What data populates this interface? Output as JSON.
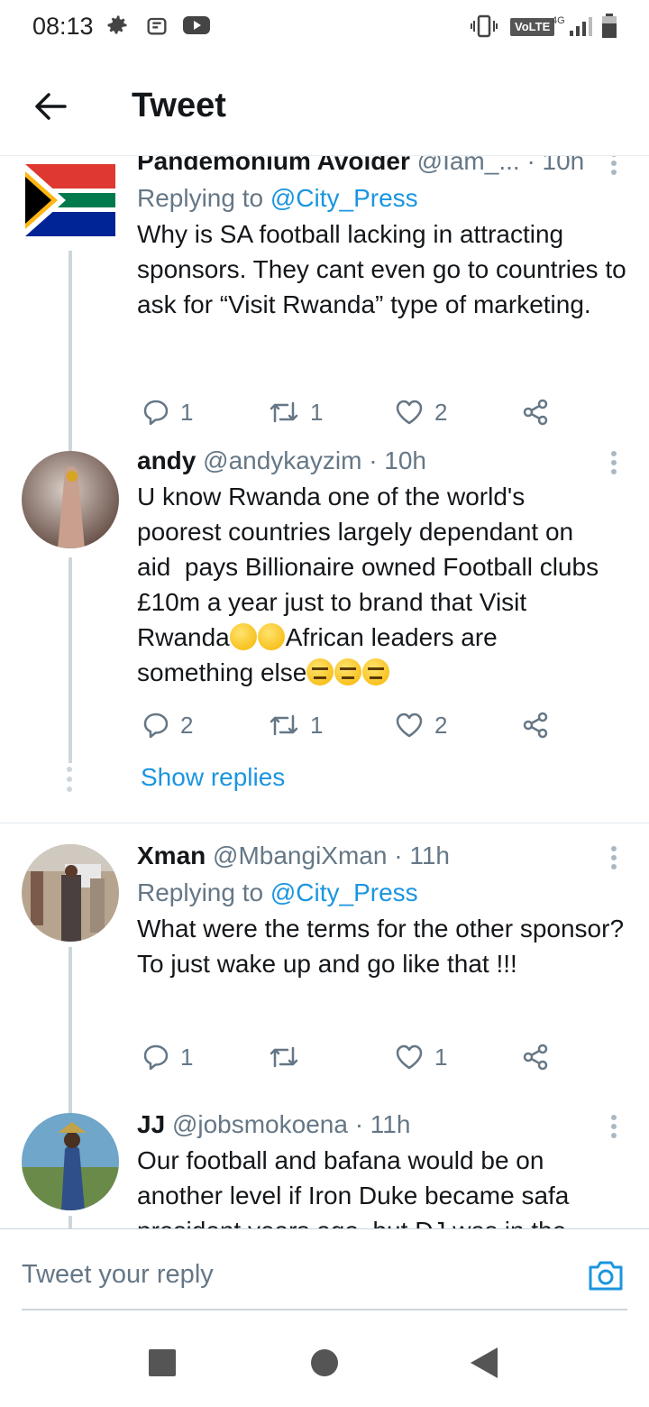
{
  "status_bar": {
    "time": "08:13",
    "icons": [
      "gear-icon",
      "android-icon",
      "youtube-icon"
    ],
    "right_icons": [
      "vibrate-icon",
      "volte-badge",
      "network-4g-icon",
      "signal-icon",
      "battery-icon"
    ],
    "volte": "VoLTE",
    "network": "4G"
  },
  "app_bar": {
    "title": "Tweet",
    "back_icon": "arrow-left-icon"
  },
  "tweets": [
    {
      "name": "Pandemonium Avoider",
      "handle": "@Iam_...",
      "time": "· 10h",
      "replying_prefix": "Replying to ",
      "replying_handle": "@City_Press",
      "text": "Why is SA football lacking in attracting sponsors. They cant even go to countries to ask for “Visit Rwanda” type of marketing.",
      "replies": "1",
      "retweets": "1",
      "likes": "2"
    },
    {
      "name": "andy",
      "handle": "@andykayzim",
      "time": "· 10h",
      "text_lines": [
        "U know Rwanda one of the world's",
        "poorest countries largely dependant on",
        "aid  pays Billionaire owned Football clubs",
        "£10m a year just to brand that Visit"
      ],
      "text_line5a": "Rwanda",
      "text_line5b": "African leaders are",
      "text_line6": "something else",
      "replies": "2",
      "retweets": "1",
      "likes": "2",
      "show_replies": "Show replies"
    },
    {
      "name": "Xman",
      "handle": "@MbangiXman",
      "time": "· 11h",
      "replying_prefix": "Replying to ",
      "replying_handle": "@City_Press",
      "text": "What were the terms for the other sponsor? To just wake up and go like that !!!",
      "replies": "1",
      "retweets": "",
      "likes": "1"
    },
    {
      "name": "JJ",
      "handle": "@jobsmokoena",
      "time": "· 11h",
      "text": "Our football and bafana would be on another level if Iron Duke became safa president years ago, but DJ was in the"
    }
  ],
  "reply_bar": {
    "placeholder": "Tweet your reply",
    "camera_icon": "camera-icon"
  },
  "colors": {
    "accent": "#1b95e0",
    "secondary_text": "#657786",
    "divider": "#e1e8ed"
  }
}
